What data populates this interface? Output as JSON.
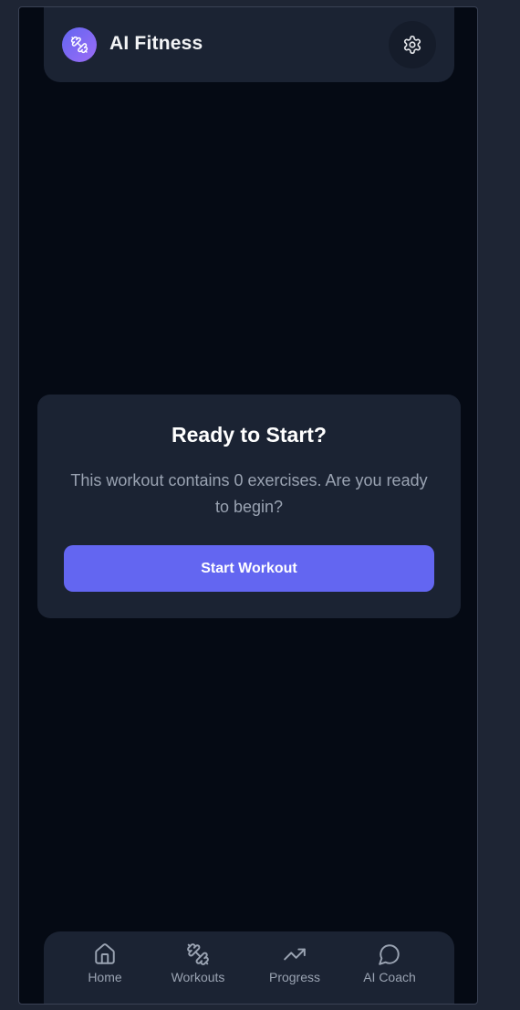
{
  "header": {
    "title": "AI Fitness",
    "logo_icon": "dumbbell-icon",
    "settings_icon": "gear-icon"
  },
  "card": {
    "title": "Ready to Start?",
    "message": "This workout contains 0 exercises. Are you ready to begin?",
    "button_label": "Start Workout"
  },
  "nav": {
    "items": [
      {
        "label": "Home",
        "icon": "home-icon"
      },
      {
        "label": "Workouts",
        "icon": "dumbbell-icon"
      },
      {
        "label": "Progress",
        "icon": "trending-up-icon"
      },
      {
        "label": "AI Coach",
        "icon": "chat-bubble-icon"
      }
    ]
  },
  "colors": {
    "accent": "#6366f1",
    "surface": "#1b2333",
    "background": "#050a14"
  }
}
